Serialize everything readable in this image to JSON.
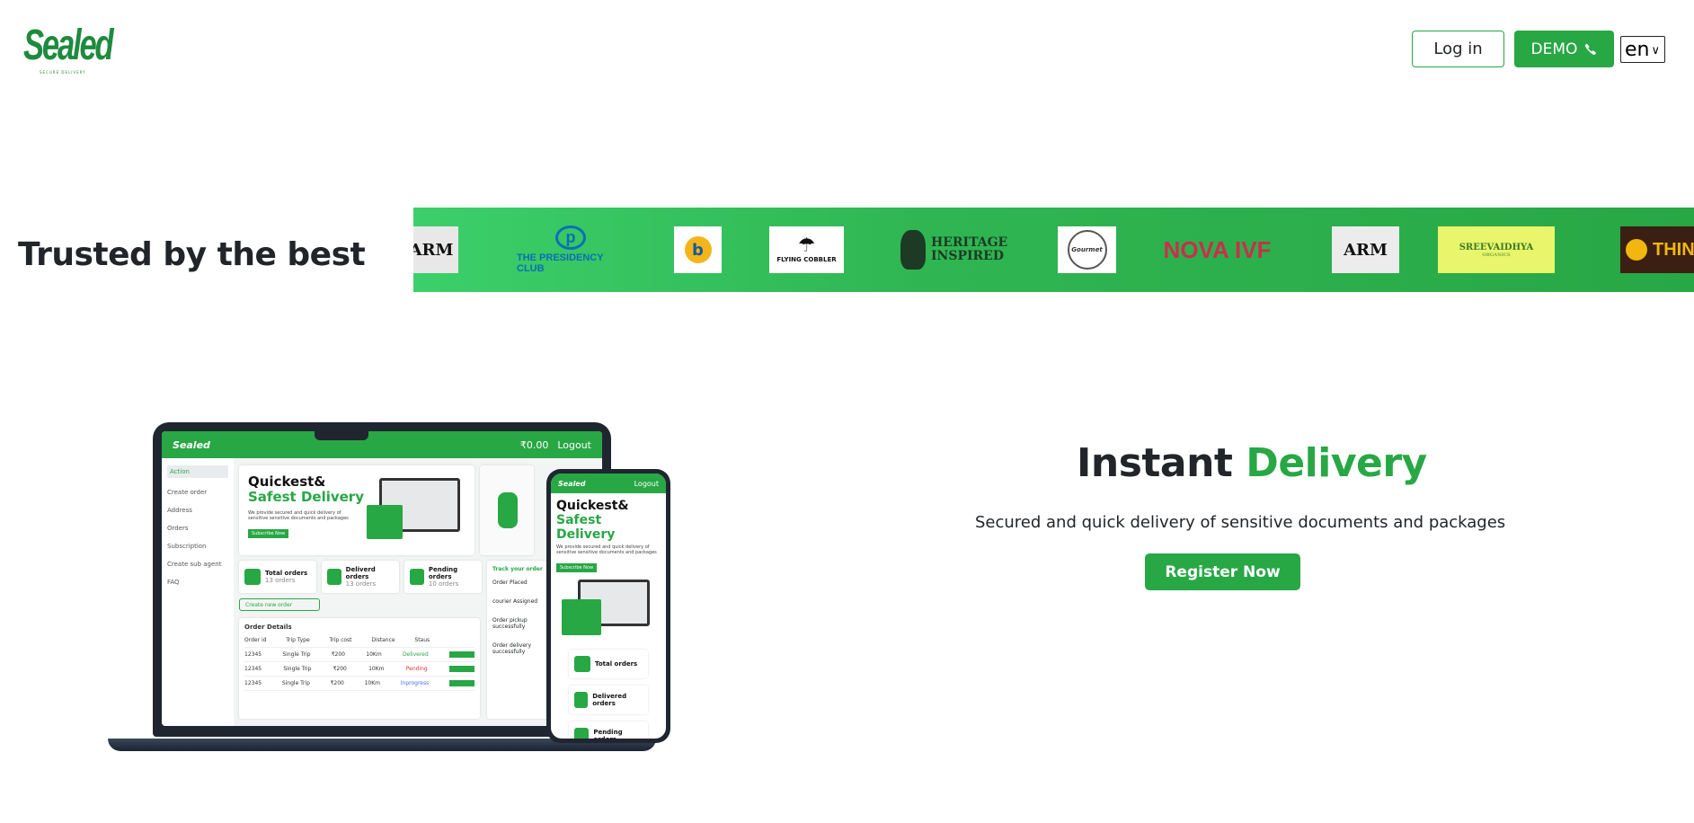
{
  "brand": {
    "logo_text": "Sealed",
    "logo_tagline": "SECURE DELIVERY"
  },
  "header": {
    "login_label": "Log in",
    "demo_label": "DEMO",
    "demo_icon": "phone-icon",
    "language": {
      "selected": "en"
    }
  },
  "trusted": {
    "title": "Trusted by the best",
    "partners": [
      {
        "name": "ARM",
        "label": "ARM"
      },
      {
        "name": "The Presidency Club",
        "label": "THE PRESIDENCY CLUB"
      },
      {
        "name": "Bottleshake",
        "label": "b"
      },
      {
        "name": "Flying Cobbler",
        "label": "FLYING COBBLER"
      },
      {
        "name": "Heritage Inspired",
        "label": "HERITAGE INSPIRED"
      },
      {
        "name": "Gourmet",
        "label": "Gourmet"
      },
      {
        "name": "Nova IVF",
        "label": "NOVA IVF"
      },
      {
        "name": "ARM",
        "label": "ARM"
      },
      {
        "name": "Sreevaidhya Organics",
        "label": "SREEVAIDHYA"
      },
      {
        "name": "Sana's Thina Organics",
        "label": "THINA"
      }
    ]
  },
  "hero": {
    "title_prefix": "Instant",
    "title_accent": "Delivery",
    "subtitle": "Secured and quick delivery of sensitive documents and packages",
    "cta_label": "Register Now"
  },
  "mockup": {
    "app_logo": "Sealed",
    "wallet": "₹0.00",
    "logout": "Logout",
    "sidebar": [
      "Action",
      "Create order",
      "Address",
      "Orders",
      "Subscription",
      "Create sub agent",
      "FAQ"
    ],
    "banner_line1": "Quickest&",
    "banner_line2": "Safest Delivery",
    "banner_desc": "We provide secured and quick delivery of sensitive sensitive documents and packages",
    "subscribe": "Subscribe Now",
    "stats": [
      {
        "label": "Total orders",
        "count": "13 orders"
      },
      {
        "label": "Deliverd orders",
        "count": "13 orders"
      },
      {
        "label": "Pending orders",
        "count": "10 orders"
      }
    ],
    "create_order": "Create new order",
    "track_title": "Track your order",
    "track_steps": [
      "Order Placed",
      "courier Assigned",
      "Order pickup successfully",
      "Order delivery successfully"
    ],
    "order_details_title": "Order Details",
    "table_headers": [
      "Order id",
      "Trip Type",
      "Trip cost",
      "Distance",
      "Staus"
    ],
    "table_rows": [
      [
        "12345",
        "Single Trip",
        "₹200",
        "10Km",
        "Delivered"
      ],
      [
        "12345",
        "Single Trip",
        "₹200",
        "10Km",
        "Pending"
      ],
      [
        "12345",
        "Single Trip",
        "₹200",
        "10Km",
        "Inprogress"
      ]
    ],
    "phone_stats": [
      "Total orders",
      "Delivered orders",
      "Pending orders"
    ]
  },
  "colors": {
    "accent": "#28a745",
    "text": "#212529"
  }
}
